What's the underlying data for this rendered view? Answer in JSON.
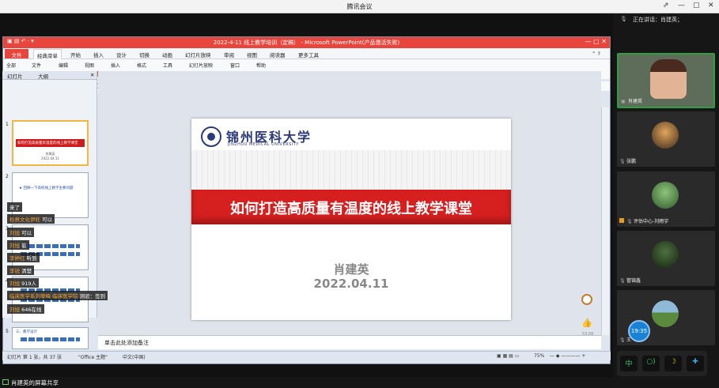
{
  "app_title": "腾讯会议",
  "window_controls": [
    "⇗",
    "—",
    "▢",
    "✕"
  ],
  "ppt": {
    "title_bar": "2022-4-11 线上教学培训（定稿） - Microsoft PowerPoint(产品激活失败)",
    "file_tab": "文件",
    "tabs": [
      "经典菜单",
      "开始",
      "插入",
      "设计",
      "切换",
      "动画",
      "幻灯片放映",
      "审阅",
      "视图",
      "阅读器",
      "更多工具"
    ],
    "menu": [
      "全部",
      "文件",
      "编辑",
      "视图",
      "插入",
      "格式",
      "工具",
      "幻灯片放映",
      "窗口",
      "帮助"
    ],
    "panel_tabs": [
      "幻灯片",
      "大纲"
    ],
    "slide": {
      "university_cn": "锦州医科大学",
      "university_en": "JINZHOU MEDICAL UNIVERSITY",
      "headline": "如何打造高质量有温度的线上教学课堂",
      "author": "肖建英",
      "date": "2022.04.11"
    },
    "thumb1_headline": "如何打造高质量有温度的线上教学课堂",
    "thumb1_author": "肖建英",
    "thumb1_date": "2022.04.11",
    "thumb2_title": "★ 回顾一下高校线上教学主要问题",
    "thumb5_title": "三、教学设计",
    "notes_placeholder": "单击此处添加备注",
    "status": {
      "slide_info": "幻灯片 第 1 张，共 37 张",
      "theme": "\"Office 主题\"",
      "language": "中文(中国)",
      "zoom": "75%"
    },
    "timer": "53:06"
  },
  "chat": [
    {
      "name": "",
      "text": "来了"
    },
    {
      "name": "检察文化伊旺",
      "text": "可以"
    },
    {
      "name": "刘旭",
      "text": "可以"
    },
    {
      "name": "刘旭",
      "text": "能"
    },
    {
      "name": "李婷红",
      "text": "听到"
    },
    {
      "name": "李锐",
      "text": "清楚"
    },
    {
      "name": "刘旭",
      "text": "919人"
    },
    {
      "name": "临床医学系刘翠梅 临床医学院",
      "text": "测验：签到"
    },
    {
      "name": "刘旭",
      "text": "646在线"
    }
  ],
  "share_status": "肖建英的屏幕共享",
  "meeting": {
    "speaker_label": "正在讲话：肖建英；",
    "participants": [
      {
        "name": "肖建英",
        "active": true
      },
      {
        "name": "张鹏",
        "active": false
      },
      {
        "name": "评估中心-刘雨宇",
        "active": false
      },
      {
        "name": "管锦鑫",
        "active": false
      },
      {
        "name": "王",
        "active": false
      }
    ],
    "clock": "19:35",
    "toolbar": [
      "中",
      "○)",
      "☽",
      "✚"
    ]
  }
}
